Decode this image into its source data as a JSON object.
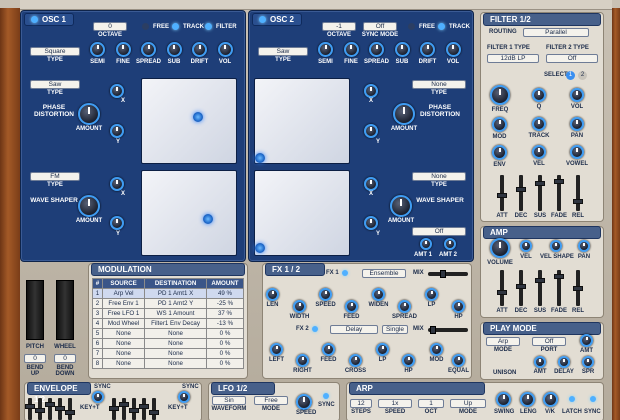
{
  "osc1": {
    "title": "OSC 1",
    "octave_value": "0",
    "octave_label": "OCTAVE",
    "free": "FREE",
    "track": "TRACK",
    "filter": "FILTER",
    "type_value": "Square",
    "type_label": "TYPE",
    "knobs": [
      "SEMI",
      "FINE",
      "SPREAD",
      "SUB",
      "DRIFT",
      "VOL"
    ],
    "pd_type": "Saw",
    "pd_type_label": "TYPE",
    "pd_name": "PHASE DISTORTION",
    "amount": "AMOUNT",
    "x": "X",
    "y": "Y",
    "ws_type": "FM",
    "ws_type_label": "TYPE",
    "ws_name": "WAVE SHAPER",
    "ws_amount": "AMOUNT",
    "wx": "X",
    "wy": "Y"
  },
  "osc2": {
    "title": "OSC 2",
    "octave_value": "-1",
    "octave_label": "OCTAVE",
    "sync_value": "Off",
    "sync_label": "SYNC MODE",
    "free": "FREE",
    "track": "TRACK",
    "type_value": "Saw",
    "type_label": "TYPE",
    "knobs": [
      "SEMI",
      "FINE",
      "SPREAD",
      "SUB",
      "DRIFT",
      "VOL"
    ],
    "pd_type": "None",
    "pd_type_label": "TYPE",
    "pd_name": "PHASE DISTORTION",
    "amount": "AMOUNT",
    "x": "X",
    "y": "Y",
    "ws_type": "None",
    "ws_type_label": "TYPE",
    "ws_name": "WAVE SHAPER",
    "ws_amount": "AMOUNT",
    "wx": "X",
    "wy": "Y",
    "amt_value": "Off",
    "amt1": "AMT 1",
    "amt2": "AMT 2"
  },
  "filter": {
    "title": "FILTER 1/2",
    "routing_label": "ROUTING",
    "routing_value": "Parallel",
    "f1_label": "FILTER 1 TYPE",
    "f2_label": "FILTER 2 TYPE",
    "f1_value": "12dB LP",
    "f2_value": "Off",
    "select_label": "SELECT",
    "select_1": "1",
    "select_2": "2",
    "knobs": [
      "FREQ",
      "Q",
      "VOL",
      "MOD",
      "TRACK",
      "PAN",
      "ENV",
      "VEL",
      "VOWEL"
    ],
    "faders": [
      "ATT",
      "DEC",
      "SUS",
      "FADE",
      "REL"
    ]
  },
  "amp": {
    "title": "AMP",
    "knobs": [
      "VOLUME",
      "VEL",
      "VEL SHAPE",
      "PAN"
    ],
    "faders": [
      "ATT",
      "DEC",
      "SUS",
      "FADE",
      "REL"
    ]
  },
  "modulation": {
    "title": "MODULATION",
    "headers": [
      "#",
      "SOURCE",
      "DESTINATION",
      "AMOUNT"
    ],
    "rows": [
      [
        "1",
        "Arp Vel",
        "PD 1 Amt1 X",
        "49 %"
      ],
      [
        "2",
        "Free Env 1",
        "PD 1 Amt2 Y",
        "-25 %"
      ],
      [
        "3",
        "Free LFO 1",
        "WS 1 Amount",
        "37 %"
      ],
      [
        "4",
        "Mod Wheel",
        "Filter1 Env Decay",
        "-13 %"
      ],
      [
        "5",
        "None",
        "None",
        "0 %"
      ],
      [
        "6",
        "None",
        "None",
        "0 %"
      ],
      [
        "7",
        "None",
        "None",
        "0 %"
      ],
      [
        "8",
        "None",
        "None",
        "0 %"
      ]
    ]
  },
  "pitch": {
    "pitch_label": "PITCH",
    "wheel_label": "WHEEL",
    "bend_up_value": "0",
    "bend_down_value": "0",
    "bend_up": "BEND UP",
    "bend_down": "BEND DOWN"
  },
  "fx": {
    "title": "FX 1 / 2",
    "fx1": "FX 1",
    "fx1_type": "Ensemble",
    "mix": "MIX",
    "fx1_knobs": [
      "LEN",
      "WIDTH",
      "SPEED",
      "FEED",
      "WIDEN",
      "SPREAD",
      "LP",
      "HP"
    ],
    "fx2": "FX 2",
    "fx2_type": "Delay",
    "fx2_mode": "Single",
    "mix2": "MIX",
    "fx2_knobs": [
      "LEFT",
      "RIGHT",
      "FEED",
      "CROSS",
      "LP",
      "HP",
      "MOD",
      "EQUAL"
    ]
  },
  "play": {
    "title": "PLAY MODE",
    "mode_value": "Arp",
    "mode_label": "MODE",
    "port_value": "Off",
    "port_label": "PORT",
    "amt": "AMT",
    "unison": "UNISON",
    "knobs": [
      "AMT",
      "DELAY",
      "SPR"
    ]
  },
  "envelope": {
    "title": "ENVELOPE 1/2",
    "sync1": "SYNC",
    "sync2": "SYNC",
    "keyt1": "KEY+T",
    "keyt2": "KEY+T"
  },
  "lfo": {
    "title": "LFO 1/2",
    "waveform_value": "Sin",
    "waveform_label": "WAVEFORM",
    "mode_value": "Free",
    "mode_label": "MODE",
    "speed": "SPEED",
    "sync": "SYNC"
  },
  "arp": {
    "title": "ARP",
    "steps_value": "12",
    "steps_label": "STEPS",
    "speed_value": "1x",
    "speed_label": "SPEED",
    "oct_value": "1",
    "oct_label": "OCT",
    "mode_value": "Up",
    "mode_label": "MODE",
    "swing": "SWING",
    "leng": "LENG",
    "vk": "V/K",
    "latch": "LATCH",
    "sync": "SYNC"
  }
}
